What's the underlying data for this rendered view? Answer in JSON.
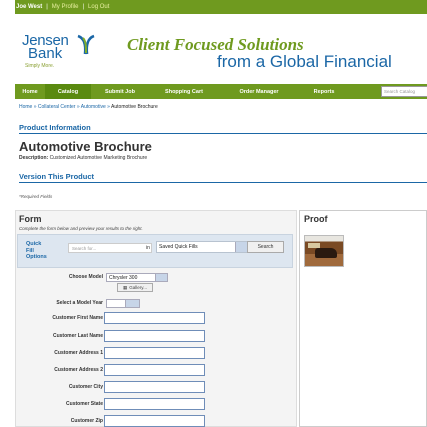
{
  "topbar": {
    "user": "Joe West",
    "profile_link": "My Profile",
    "logout_link": "Log Out"
  },
  "brand": {
    "line1": "Jensen",
    "line2": "Bank",
    "tagline_small": "Simply More.",
    "headline": "Client Focused Solutions",
    "subheadline": "from a Global Financial"
  },
  "nav": {
    "items": [
      "Home",
      "Catalog",
      "Submit Job",
      "Shopping Cart",
      "Order Manager",
      "Reports"
    ],
    "active": "Catalog",
    "search_placeholder": "Search Catalog"
  },
  "breadcrumb": {
    "items": [
      "Home",
      "Collateral Center",
      "Automotive"
    ],
    "current": "Automotive Brochure",
    "separator": "»"
  },
  "product": {
    "section_label": "Product Information",
    "title": "Automotive Brochure",
    "description_label": "Description:",
    "description": "Customized Automotive Marketing Brochure",
    "version_label": "Version This Product",
    "required_note": "*Required Fields"
  },
  "form": {
    "title": "Form",
    "hint": "Complete the form below and preview your results to the right.",
    "quick_fill": {
      "label": "Quick Fill Options",
      "search_placeholder": "Search for...",
      "in_label": "in",
      "selected": "Saved Quick Fills",
      "button": "Search"
    },
    "choose_model_label": "Choose Model",
    "model_value": "Chrysler 300",
    "gallery_button": "Gallery...",
    "model_year_label": "Select a Model Year",
    "fields": [
      "Customer First Name",
      "Customer Last Name",
      "Customer Address 1",
      "Customer Address 2",
      "Customer City",
      "Customer State",
      "Customer Zip"
    ]
  },
  "proof": {
    "title": "Proof"
  },
  "colors": {
    "brand_green": "#6f9a1f",
    "brand_blue": "#1b67a6"
  }
}
